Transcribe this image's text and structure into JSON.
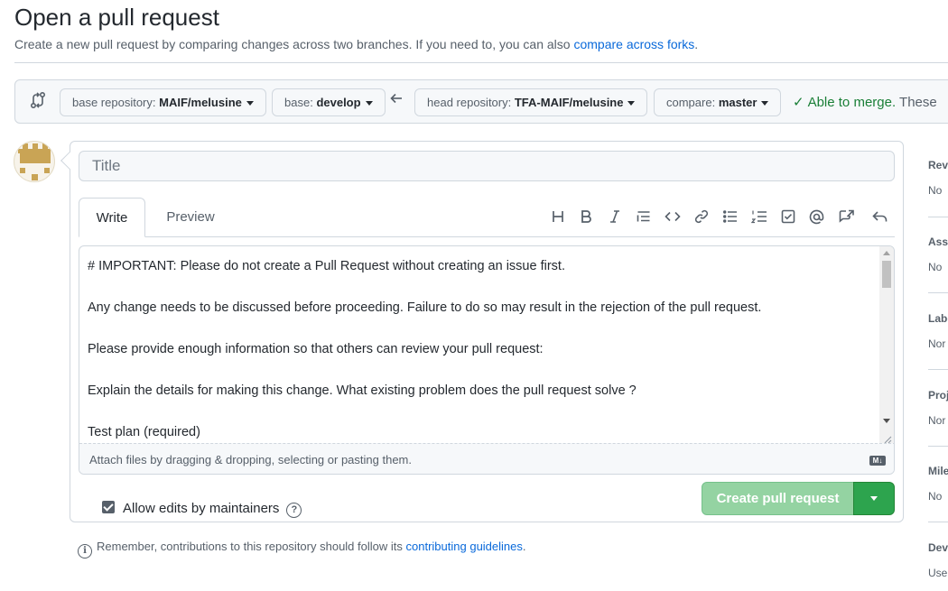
{
  "header": {
    "title": "Open a pull request",
    "subtitle_prefix": "Create a new pull request by comparing changes across two branches. If you need to, you can also",
    "subtitle_link": "compare across forks",
    "subtitle_suffix": "."
  },
  "range": {
    "base_repo_label": "base repository:",
    "base_repo_value": "MAIF/melusine",
    "base_label": "base:",
    "base_value": "develop",
    "head_repo_label": "head repository:",
    "head_repo_value": "TFA-MAIF/melusine",
    "compare_label": "compare:",
    "compare_value": "master",
    "merge_status": "Able to merge.",
    "merge_status_rest": "These"
  },
  "form": {
    "title_placeholder": "Title",
    "tabs": {
      "write": "Write",
      "preview": "Preview"
    },
    "toolbar": [
      "heading-icon",
      "bold-icon",
      "italic-icon",
      "quote-icon",
      "code-icon",
      "link-icon",
      "unordered-list-icon",
      "ordered-list-icon",
      "task-list-icon",
      "mention-icon",
      "cross-reference-icon",
      "reply-icon"
    ],
    "body": "# IMPORTANT: Please do not create a Pull Request without creating an issue first.\n\nAny change needs to be discussed before proceeding. Failure to do so may result in the rejection of the pull request.\n\nPlease provide enough information so that others can review your pull request:\n\nExplain the details for making this change. What existing problem does the pull request solve ?\n\nTest plan (required)",
    "attach_hint": "Attach files by dragging & dropping, selecting or pasting them.",
    "markdown_badge": "M↓",
    "allow_edits_label": "Allow edits by maintainers",
    "allow_edits_checked": true,
    "help_glyph": "?",
    "create_button": "Create pull request"
  },
  "footer": {
    "info_glyph": "i",
    "note_prefix": "Remember, contributions to this repository should follow its",
    "note_link": "contributing guidelines",
    "note_suffix": "."
  },
  "sidebar": [
    {
      "head": "Rev",
      "value": "No"
    },
    {
      "head": "Assi",
      "value": "No"
    },
    {
      "head": "Labe",
      "value": "Nor"
    },
    {
      "head": "Proj",
      "value": "Nor"
    },
    {
      "head": "Mile",
      "value": "No"
    },
    {
      "head": "Dev",
      "value": "Use"
    }
  ],
  "colors": {
    "link": "#0969da",
    "success": "#1a7f37",
    "primary_button": "#2da44e",
    "primary_button_disabled": "#94d3a2"
  }
}
